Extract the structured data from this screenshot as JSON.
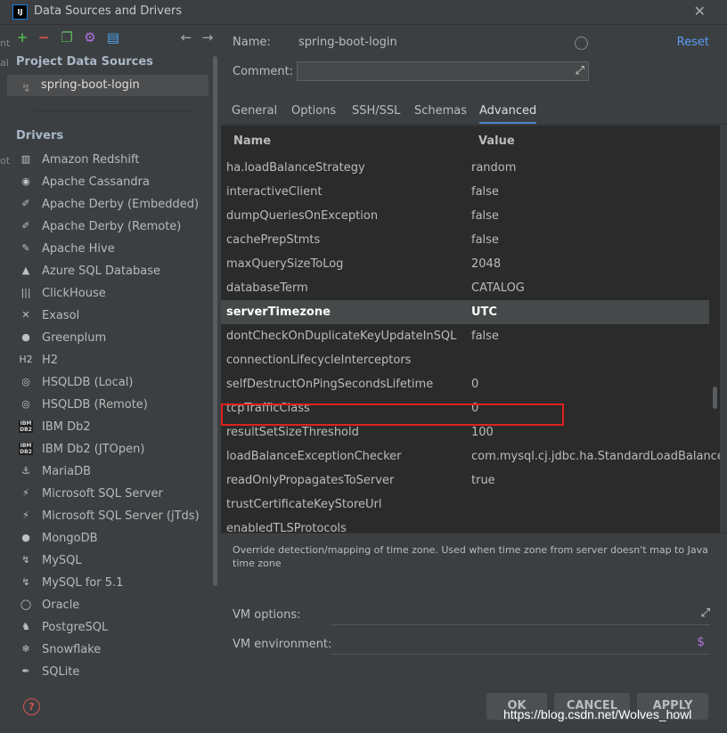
{
  "window": {
    "logo": "IJ",
    "title": "Data Sources and Drivers"
  },
  "left": {
    "left_edge_text": [
      "nt",
      "al",
      "",
      "",
      "",
      "",
      "ot"
    ],
    "project_section": "Project Data Sources",
    "selected_source": "spring-boot-login",
    "drivers_section": "Drivers",
    "drivers": [
      {
        "label": "Amazon Redshift",
        "icon": "redshift-icon",
        "glyph": "▥"
      },
      {
        "label": "Apache Cassandra",
        "icon": "cassandra-icon",
        "glyph": "◉"
      },
      {
        "label": "Apache Derby (Embedded)",
        "icon": "derby-icon",
        "glyph": "✐"
      },
      {
        "label": "Apache Derby (Remote)",
        "icon": "derby-icon",
        "glyph": "✐"
      },
      {
        "label": "Apache Hive",
        "icon": "hive-icon",
        "glyph": "✎"
      },
      {
        "label": "Azure SQL Database",
        "icon": "azure-icon",
        "glyph": "▲"
      },
      {
        "label": "ClickHouse",
        "icon": "clickhouse-icon",
        "glyph": "|||"
      },
      {
        "label": "Exasol",
        "icon": "exasol-icon",
        "glyph": "✕"
      },
      {
        "label": "Greenplum",
        "icon": "greenplum-icon",
        "glyph": "●"
      },
      {
        "label": "H2",
        "icon": "h2-icon",
        "glyph": "H2"
      },
      {
        "label": "HSQLDB (Local)",
        "icon": "hsqldb-icon",
        "glyph": "◎"
      },
      {
        "label": "HSQLDB (Remote)",
        "icon": "hsqldb-icon",
        "glyph": "◎"
      },
      {
        "label": "IBM Db2",
        "icon": "ibm-db2-icon",
        "glyph": "IBM DB2"
      },
      {
        "label": "IBM Db2 (JTOpen)",
        "icon": "ibm-db2-icon",
        "glyph": "IBM DB2"
      },
      {
        "label": "MariaDB",
        "icon": "mariadb-icon",
        "glyph": "⚓"
      },
      {
        "label": "Microsoft SQL Server",
        "icon": "sqlserver-icon",
        "glyph": "⚡"
      },
      {
        "label": "Microsoft SQL Server (jTds)",
        "icon": "sqlserver-icon",
        "glyph": "⚡"
      },
      {
        "label": "MongoDB",
        "icon": "mongodb-icon",
        "glyph": "●"
      },
      {
        "label": "MySQL",
        "icon": "mysql-icon",
        "glyph": "↯"
      },
      {
        "label": "MySQL for 5.1",
        "icon": "mysql-icon",
        "glyph": "↯"
      },
      {
        "label": "Oracle",
        "icon": "oracle-icon",
        "glyph": "◯"
      },
      {
        "label": "PostgreSQL",
        "icon": "postgresql-icon",
        "glyph": "♞"
      },
      {
        "label": "Snowflake",
        "icon": "snowflake-icon",
        "glyph": "❄"
      },
      {
        "label": "SQLite",
        "icon": "sqlite-icon",
        "glyph": "✒"
      }
    ]
  },
  "form": {
    "name_label": "Name:",
    "name_value": "spring-boot-login",
    "reset": "Reset",
    "comment_label": "Comment:"
  },
  "tabs": [
    "General",
    "Options",
    "SSH/SSL",
    "Schemas",
    "Advanced"
  ],
  "active_tab": "Advanced",
  "table": {
    "col_name": "Name",
    "col_value": "Value",
    "rows": [
      {
        "name": "ha.loadBalanceStrategy",
        "value": "random"
      },
      {
        "name": "interactiveClient",
        "value": "false"
      },
      {
        "name": "dumpQueriesOnException",
        "value": "false"
      },
      {
        "name": "cachePrepStmts",
        "value": "false"
      },
      {
        "name": "maxQuerySizeToLog",
        "value": "2048"
      },
      {
        "name": "databaseTerm",
        "value": "CATALOG"
      },
      {
        "name": "serverTimezone",
        "value": "UTC"
      },
      {
        "name": "dontCheckOnDuplicateKeyUpdateInSQL",
        "value": "false"
      },
      {
        "name": "connectionLifecycleInterceptors",
        "value": ""
      },
      {
        "name": "selfDestructOnPingSecondsLifetime",
        "value": "0"
      },
      {
        "name": "tcpTrafficClass",
        "value": "0"
      },
      {
        "name": "resultSetSizeThreshold",
        "value": "100"
      },
      {
        "name": "loadBalanceExceptionChecker",
        "value": "com.mysql.cj.jdbc.ha.StandardLoadBalance..."
      },
      {
        "name": "readOnlyPropagatesToServer",
        "value": "true"
      },
      {
        "name": "trustCertificateKeyStoreUrl",
        "value": ""
      },
      {
        "name": "enabledTLSProtocols",
        "value": ""
      }
    ],
    "selected_row": "serverTimezone"
  },
  "description": "Override detection/mapping of time zone. Used when time zone from server doesn't map to Java time zone",
  "vm": {
    "options_label": "VM options:",
    "environment_label": "VM environment:"
  },
  "buttons": {
    "ok": "OK",
    "cancel": "CANCEL",
    "apply": "APPLY"
  },
  "watermark": "https://blog.csdn.net/Wolves_howl",
  "colors": {
    "accent": "#4a88c7",
    "link": "#589df6",
    "highlight_box": "#e02020",
    "help": "#d9534f"
  }
}
